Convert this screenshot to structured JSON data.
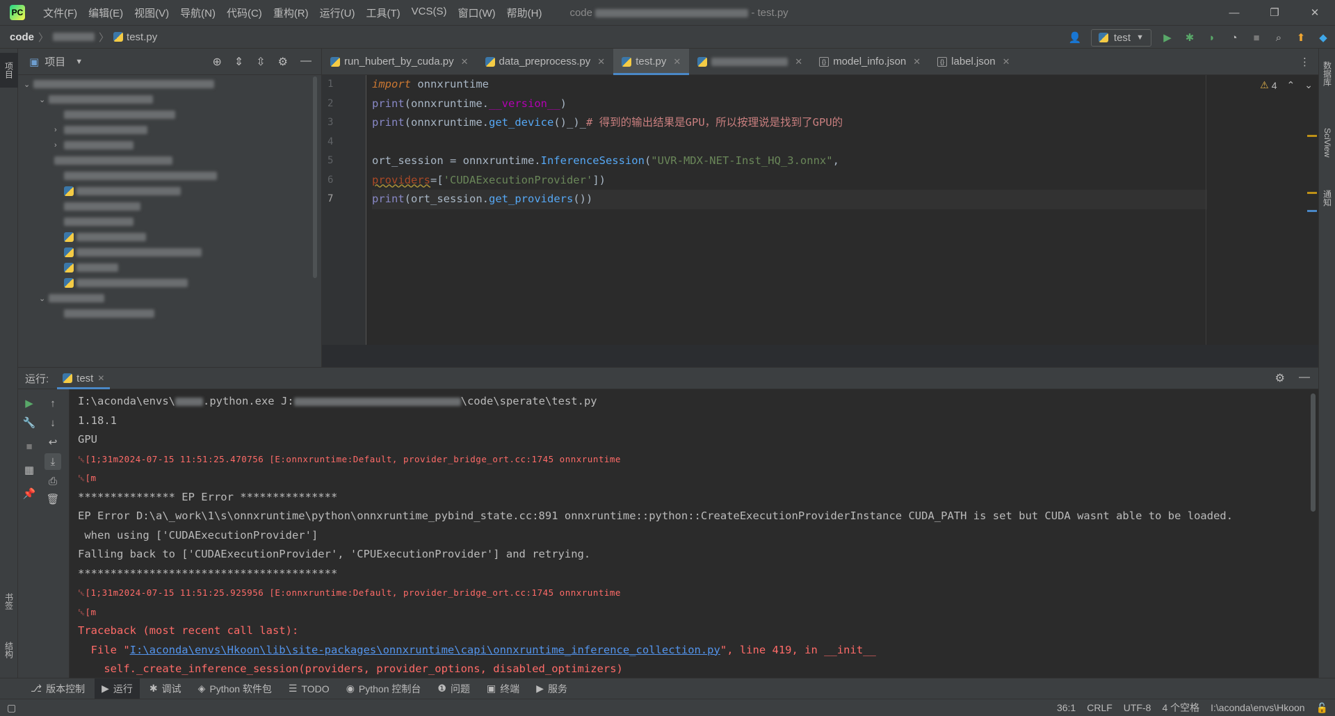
{
  "titlebar": {
    "menu": [
      "文件(F)",
      "编辑(E)",
      "视图(V)",
      "导航(N)",
      "代码(C)",
      "重构(R)",
      "运行(U)",
      "工具(T)",
      "VCS(S)",
      "窗口(W)",
      "帮助(H)"
    ],
    "title_prefix": "code",
    "title_suffix": "- test.py",
    "minimize": "—",
    "restore": "❐",
    "close": "✕"
  },
  "navbar": {
    "project": "code",
    "file": "test.py",
    "run_config": "test"
  },
  "left_strip": {
    "project_tab": "项目",
    "bookmarks_tab": "书签",
    "structure_tab": "结构"
  },
  "right_strip": {
    "database_tab": "数据库",
    "sciview_tab": "SciView",
    "notifications_tab": "通知"
  },
  "project_panel": {
    "title": "项目"
  },
  "editor_tabs": [
    {
      "label": "run_hubert_by_cuda.py",
      "type": "py"
    },
    {
      "label": "data_preprocess.py",
      "type": "py"
    },
    {
      "label": "test.py",
      "type": "py",
      "active": true
    },
    {
      "label": "",
      "type": "py"
    },
    {
      "label": "model_info.json",
      "type": "json"
    },
    {
      "label": "label.json",
      "type": "json"
    }
  ],
  "editor": {
    "line_numbers": [
      "1",
      "2",
      "3",
      "4",
      "5",
      "6",
      "7"
    ],
    "warning_count": "4",
    "lines": {
      "l1_kw": "import",
      "l1_rest": " onnxruntime",
      "l2_print": "print",
      "l2_a": "(onnxruntime.",
      "l2_dunder": "__version__",
      "l2_b": ")",
      "l3_print": "print",
      "l3_a": "(onnxruntime.",
      "l3_fn": "get_device",
      "l3_b": "()_)_",
      "l3_comment": "# 得到的输出结果是GPU，所以按理说是找到了GPU的",
      "l5_a": "ort_session = onnxruntime.",
      "l5_fn": "InferenceSession",
      "l5_b": "(",
      "l5_str": "\"UVR-MDX-NET-Inst_HQ_3.onnx\"",
      "l5_c": ",",
      "l6_param": "providers",
      "l6_a": "=[",
      "l6_str": "'CUDAExecutionProvider'",
      "l6_b": "])",
      "l7_print": "print",
      "l7_a": "(ort_session.",
      "l7_fn": "get_providers",
      "l7_b": "())"
    }
  },
  "run_panel": {
    "label": "运行:",
    "tab": "test"
  },
  "console": {
    "cmd_a": "I:\\aconda\\envs\\",
    "cmd_b": ".python.exe J:",
    "cmd_c": "\\code\\sperate\\test.py",
    "version": "1.18.1",
    "device": "GPU",
    "esc1": "␛[1;31m2024-07-15 11:51:25.470756 [E:onnxruntime:Default, provider_bridge_ort.cc:1745 onnxruntime",
    "esc1b": "␛[m",
    "ep_header": "*************** EP Error ***************",
    "ep_error": "EP Error D:\\a\\_work\\1\\s\\onnxruntime\\python\\onnxruntime_pybind_state.cc:891 onnxruntime::python::CreateExecutionProviderInstance CUDA_PATH is set but CUDA wasnt able to be loaded.",
    "ep_error2": " when using ['CUDAExecutionProvider']",
    "fallback": "Falling back to ['CUDAExecutionProvider', 'CPUExecutionProvider'] and retrying.",
    "stars": "****************************************",
    "esc2": "␛[1;31m2024-07-15 11:51:25.925956 [E:onnxruntime:Default, provider_bridge_ort.cc:1745 onnxruntime",
    "esc2b": "␛[m",
    "traceback": "Traceback (most recent call last):",
    "file_pre": "  File \"",
    "file_link": "I:\\aconda\\envs\\Hkoon\\lib\\site-packages\\onnxruntime\\capi\\onnxruntime_inference_collection.py",
    "file_post": "\", line 419, in __init__",
    "self_line": "    self._create_inference_session(providers, provider_options, disabled_optimizers)"
  },
  "toolwin": [
    {
      "label": "版本控制",
      "icon": "⎇"
    },
    {
      "label": "运行",
      "icon": "▶",
      "active": true
    },
    {
      "label": "调试",
      "icon": "✱"
    },
    {
      "label": "Python 软件包",
      "icon": "◈"
    },
    {
      "label": "TODO",
      "icon": "☰"
    },
    {
      "label": "Python 控制台",
      "icon": "◉"
    },
    {
      "label": "问题",
      "icon": "❶"
    },
    {
      "label": "终端",
      "icon": "▣"
    },
    {
      "label": "服务",
      "icon": "▶"
    }
  ],
  "status": {
    "position": "36:1",
    "line_sep": "CRLF",
    "encoding": "UTF-8",
    "indent": "4 个空格",
    "interpreter": "I:\\aconda\\envs\\Hkoon"
  },
  "colors": {
    "accent": "#4a88c7",
    "error": "#ff6b68",
    "keyword": "#cc7832",
    "string": "#6a8759",
    "function": "#56a8f5"
  }
}
